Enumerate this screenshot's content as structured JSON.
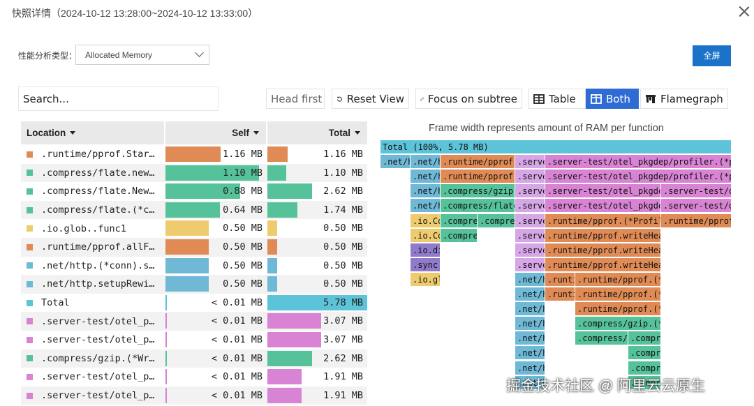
{
  "header": {
    "title": "快照详情（2024-10-12 13:28:00~2024-10-12 13:33:00）"
  },
  "profile": {
    "label": "性能分析类型：",
    "selected": "Allocated Memory"
  },
  "fullscreen_label": "全屏",
  "toolbar": {
    "search_placeholder": "Search...",
    "head_first": "Head first",
    "reset_view": "Reset View",
    "focus_subtree": "Focus on subtree",
    "table": "Table",
    "both": "Both",
    "flamegraph": "Flamegraph"
  },
  "colors": {
    "orange": "#e08b55",
    "green": "#55c29a",
    "yellow": "#eecb6e",
    "blue": "#6fb9d6",
    "cyan": "#5cc3d8",
    "pink": "#d883d3",
    "violet": "#d6a6e6",
    "purple": "#8f7bc9",
    "accent": "#2f6bd4"
  },
  "table": {
    "headers": {
      "location": "Location",
      "self": "Self",
      "total": "Total"
    },
    "rows": [
      {
        "loc": ".runtime/pprof.Star…",
        "color": "#e08b55",
        "self": "1.16 MB",
        "total": "1.16 MB",
        "self_frac": 0.56,
        "total_frac": 0.2
      },
      {
        "loc": ".compress/flate.new…",
        "color": "#55c29a",
        "self": "1.10 MB",
        "total": "1.10 MB",
        "self_frac": 0.95,
        "total_frac": 0.19
      },
      {
        "loc": ".compress/flate.New…",
        "color": "#55c29a",
        "self": "0.88 MB",
        "total": "2.62 MB",
        "self_frac": 0.76,
        "total_frac": 0.45
      },
      {
        "loc": ".compress/flate.(*c…",
        "color": "#55c29a",
        "self": "0.64 MB",
        "total": "1.74 MB",
        "self_frac": 0.55,
        "total_frac": 0.3
      },
      {
        "loc": ".io.glob..func1",
        "color": "#eecb6e",
        "self": "0.50 MB",
        "total": "0.50 MB",
        "self_frac": 0.44,
        "total_frac": 0.1
      },
      {
        "loc": ".runtime/pprof.allF…",
        "color": "#e08b55",
        "self": "0.50 MB",
        "total": "0.50 MB",
        "self_frac": 0.44,
        "total_frac": 0.1
      },
      {
        "loc": ".net/http.(*conn).s…",
        "color": "#6fb9d6",
        "self": "0.50 MB",
        "total": "0.50 MB",
        "self_frac": 0.44,
        "total_frac": 0.1
      },
      {
        "loc": ".net/http.setupRewi…",
        "color": "#6fb9d6",
        "self": "0.50 MB",
        "total": "0.50 MB",
        "self_frac": 0.44,
        "total_frac": 0.1
      },
      {
        "loc": "Total",
        "color": "#5cc3d8",
        "self": "< 0.01 MB",
        "total": "5.78 MB",
        "self_frac": 0.01,
        "total_frac": 1.0
      },
      {
        "loc": ".server-test/otel_p…",
        "color": "#d883d3",
        "self": "< 0.01 MB",
        "total": "3.07 MB",
        "self_frac": 0.01,
        "total_frac": 0.54
      },
      {
        "loc": ".server-test/otel_p…",
        "color": "#d883d3",
        "self": "< 0.01 MB",
        "total": "3.07 MB",
        "self_frac": 0.01,
        "total_frac": 0.54
      },
      {
        "loc": ".compress/gzip.(*Wr…",
        "color": "#55c29a",
        "self": "< 0.01 MB",
        "total": "2.62 MB",
        "self_frac": 0.01,
        "total_frac": 0.45
      },
      {
        "loc": ".server-test/otel_p…",
        "color": "#d883d3",
        "self": "< 0.01 MB",
        "total": "1.91 MB",
        "self_frac": 0.01,
        "total_frac": 0.34
      },
      {
        "loc": ".server-test/otel_p…",
        "color": "#d883d3",
        "self": "< 0.01 MB",
        "total": "1.91 MB",
        "self_frac": 0.01,
        "total_frac": 0.34
      }
    ]
  },
  "flamegraph": {
    "caption": "Frame width represents amount of RAM per function",
    "frames": [
      {
        "label": "Total (100%, 5.78 MB)",
        "color": "#5cc3d8"
      },
      {
        "label": ".net/h",
        "color": "#6fb9d6"
      },
      {
        "label": ".net/h",
        "color": "#6fb9d6"
      },
      {
        "label": ".runtime/pprof.p",
        "color": "#e08b55"
      },
      {
        "label": ".serve",
        "color": "#d6a6e6"
      },
      {
        "label": ".server-test/otel_pkgdep/profiler.(*prof",
        "color": "#d883d3"
      },
      {
        "label": ".net/h",
        "color": "#6fb9d6"
      },
      {
        "label": ".runtime/pprof.",
        "color": "#e08b55"
      },
      {
        "label": ".serve",
        "color": "#d6a6e6"
      },
      {
        "label": ".server-test/otel_pkgdep/profiler.(*prof",
        "color": "#d883d3"
      },
      {
        "label": ".net/h",
        "color": "#6fb9d6"
      },
      {
        "label": ".compress/gzip.",
        "color": "#55c29a"
      },
      {
        "label": ".serve",
        "color": "#d6a6e6"
      },
      {
        "label": ".server-test/otel_pkgdep/",
        "color": "#d883d3"
      },
      {
        "label": ".server-test/ot",
        "color": "#d883d3"
      },
      {
        "label": ".net/h",
        "color": "#6fb9d6"
      },
      {
        "label": ".compress/flate",
        "color": "#55c29a"
      },
      {
        "label": ".serve",
        "color": "#d6a6e6"
      },
      {
        "label": ".server-test/otel_pkgdep/",
        "color": "#d883d3"
      },
      {
        "label": ".server-test/ot",
        "color": "#d883d3"
      },
      {
        "label": ".io.Co",
        "color": "#eecb6e"
      },
      {
        "label": ".compre",
        "color": "#55c29a"
      },
      {
        "label": ".compres",
        "color": "#55c29a"
      },
      {
        "label": ".serve",
        "color": "#d6a6e6"
      },
      {
        "label": ".runtime/pprof.(*Profile)",
        "color": "#e08b55"
      },
      {
        "label": ".runtime/pprof.",
        "color": "#e08b55"
      },
      {
        "label": ".io.Co",
        "color": "#eecb6e"
      },
      {
        "label": ".compre",
        "color": "#55c29a"
      },
      {
        "label": ".serve",
        "color": "#d6a6e6"
      },
      {
        "label": ".runtime/pprof.writeHeap",
        "color": "#e08b55"
      },
      {
        "label": ".io.di",
        "color": "#8f7bc9"
      },
      {
        "label": ".serve",
        "color": "#d6a6e6"
      },
      {
        "label": ".runtime/pprof.writeHeapI",
        "color": "#e08b55"
      },
      {
        "label": ".sync.",
        "color": "#8f7bc9"
      },
      {
        "label": ".serve",
        "color": "#d6a6e6"
      },
      {
        "label": ".runtime/pprof.writeHeapP",
        "color": "#e08b55"
      },
      {
        "label": ".io.gl",
        "color": "#eecb6e"
      },
      {
        "label": ".net/h",
        "color": "#6fb9d6"
      },
      {
        "label": ".runti",
        "color": "#e08b55"
      },
      {
        "label": ".runtime/pprof.(*p",
        "color": "#e08b55"
      },
      {
        "label": ".net/h",
        "color": "#6fb9d6"
      },
      {
        "label": ".runti",
        "color": "#e08b55"
      },
      {
        "label": ".runtime/pprof.(*p",
        "color": "#e08b55"
      },
      {
        "label": ".net/h",
        "color": "#6fb9d6"
      },
      {
        "label": ".runtime/pprof.(*p",
        "color": "#e08b55"
      },
      {
        "label": ".net/h",
        "color": "#6fb9d6"
      },
      {
        "label": ".compress/gzip.(*W",
        "color": "#55c29a"
      },
      {
        "label": ".net/h",
        "color": "#6fb9d6"
      },
      {
        "label": ".compress/f",
        "color": "#55c29a"
      },
      {
        "label": ".compre",
        "color": "#55c29a"
      },
      {
        "label": ".net/h",
        "color": "#6fb9d6"
      },
      {
        "label": ".compre",
        "color": "#55c29a"
      },
      {
        "label": ".net/h",
        "color": "#6fb9d6"
      },
      {
        "label": ".compre",
        "color": "#55c29a"
      },
      {
        "label": ".net/h",
        "color": "#6fb9d6"
      },
      {
        "label": ".compre",
        "color": "#55c29a"
      }
    ]
  },
  "watermark": "掘金技术社区 @ 阿里云云原生"
}
